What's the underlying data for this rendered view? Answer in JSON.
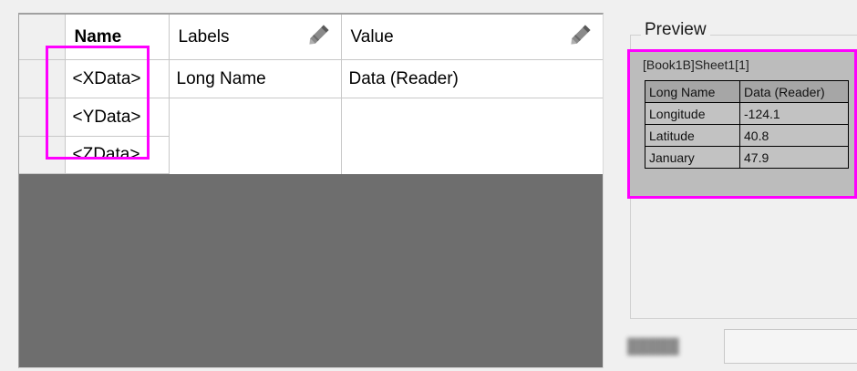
{
  "grid": {
    "headers": {
      "name": "Name",
      "labels": "Labels",
      "value": "Value"
    },
    "rows": [
      {
        "name": "<XData>",
        "labels": "Long Name",
        "value": "Data (Reader)"
      },
      {
        "name": "<YData>",
        "labels": "",
        "value": ""
      },
      {
        "name": "<ZData>",
        "labels": "",
        "value": ""
      }
    ],
    "edit_icon": "pencil-icon"
  },
  "preview": {
    "legend": "Preview",
    "sheet_title": "[Book1B]Sheet1[1]",
    "table": {
      "header": [
        "Long Name",
        "Data (Reader)"
      ],
      "rows": [
        [
          "Longitude",
          "-124.1"
        ],
        [
          "Latitude",
          "40.8"
        ],
        [
          "January",
          "47.9"
        ]
      ]
    }
  },
  "colors": {
    "highlight": "#ff00ff",
    "grid_empty_area": "#6e6e6e"
  }
}
